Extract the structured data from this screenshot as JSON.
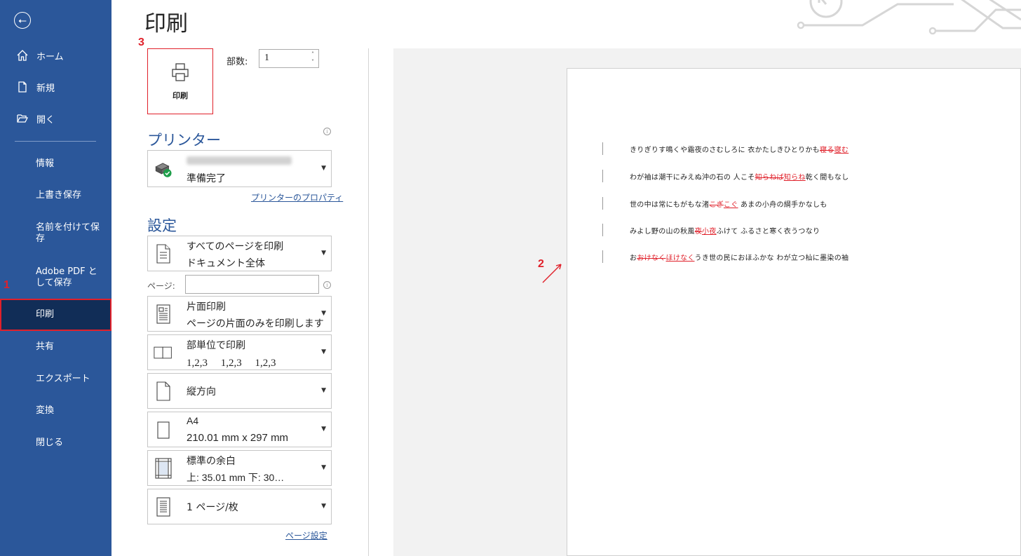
{
  "sidebar": {
    "back": "⭠",
    "items": [
      {
        "label": "ホーム",
        "icon": "home-icon"
      },
      {
        "label": "新規",
        "icon": "new-document-icon"
      },
      {
        "label": "開く",
        "icon": "open-folder-icon"
      },
      {
        "label": "情報"
      },
      {
        "label": "上書き保存"
      },
      {
        "label": "名前を付けて保存"
      },
      {
        "label": "Adobe PDF として保存"
      },
      {
        "label": "印刷"
      },
      {
        "label": "共有"
      },
      {
        "label": "エクスポート"
      },
      {
        "label": "変換"
      },
      {
        "label": "閉じる"
      }
    ]
  },
  "callouts": {
    "one": "1",
    "two": "2",
    "three": "3"
  },
  "page_title": "印刷",
  "print_button": {
    "label": "印刷",
    "icon": "printer-icon"
  },
  "copies": {
    "label": "部数:",
    "value": "1"
  },
  "printer": {
    "heading": "プリンター",
    "status": "準備完了",
    "properties_link": "プリンターのプロパティ",
    "icon": "printer-ready-icon"
  },
  "settings": {
    "heading": "設定",
    "print_range": {
      "line1": "すべてのページを印刷",
      "line2": "ドキュメント全体",
      "icon": "pages-icon"
    },
    "pages_label": "ページ:",
    "pages_value": "",
    "sides": {
      "line1": "片面印刷",
      "line2": "ページの片面のみを印刷します",
      "icon": "one-sided-icon"
    },
    "collation": {
      "line1": "部単位で印刷",
      "line2": "1,2,3　 1,2,3　 1,2,3",
      "icon": "collated-icon"
    },
    "orientation": {
      "line1": "縦方向",
      "icon": "portrait-icon"
    },
    "paper_size": {
      "line1": "A4",
      "line2": "210.01 mm x 297 mm",
      "icon": "paper-size-icon"
    },
    "margins": {
      "line1": "標準の余白",
      "line2": "上: 35.01 mm 下: 30…",
      "icon": "margins-icon"
    },
    "pages_per_sheet": {
      "line1": "1 ページ/枚",
      "icon": "pages-per-sheet-icon"
    },
    "page_setup_link": "ページ設定"
  },
  "preview": {
    "lines": [
      {
        "pre": "きりぎりす鳴くや霜夜のさむしろに 衣かたしきひとりかも",
        "del": "寝る",
        "ins": "寝む",
        "post": ""
      },
      {
        "pre": "わが袖は潮干にみえぬ沖の石の 人こそ",
        "del": "知らねば",
        "ins": "知らね",
        "post": "乾く間もなし"
      },
      {
        "pre": "世の中は常にもがもな渚",
        "del": "こぎ",
        "ins": "こぐ",
        "post": " あまの小舟の綱手かなしも"
      },
      {
        "pre": "みよし野の山の秋風",
        "del": "夜",
        "ins": "小夜",
        "post": "ふけて ふるさと寒く衣うつなり"
      },
      {
        "pre": "お",
        "del": "おけなく",
        "ins": "ほけなく",
        "post": "うき世の民におほふかな わが立つ杣に墨染の袖"
      }
    ]
  },
  "colors": {
    "sidebar": "#2b579a",
    "sidebar_active": "#112d57",
    "accent_red": "#e0202a",
    "heading_blue": "#2b579a"
  }
}
